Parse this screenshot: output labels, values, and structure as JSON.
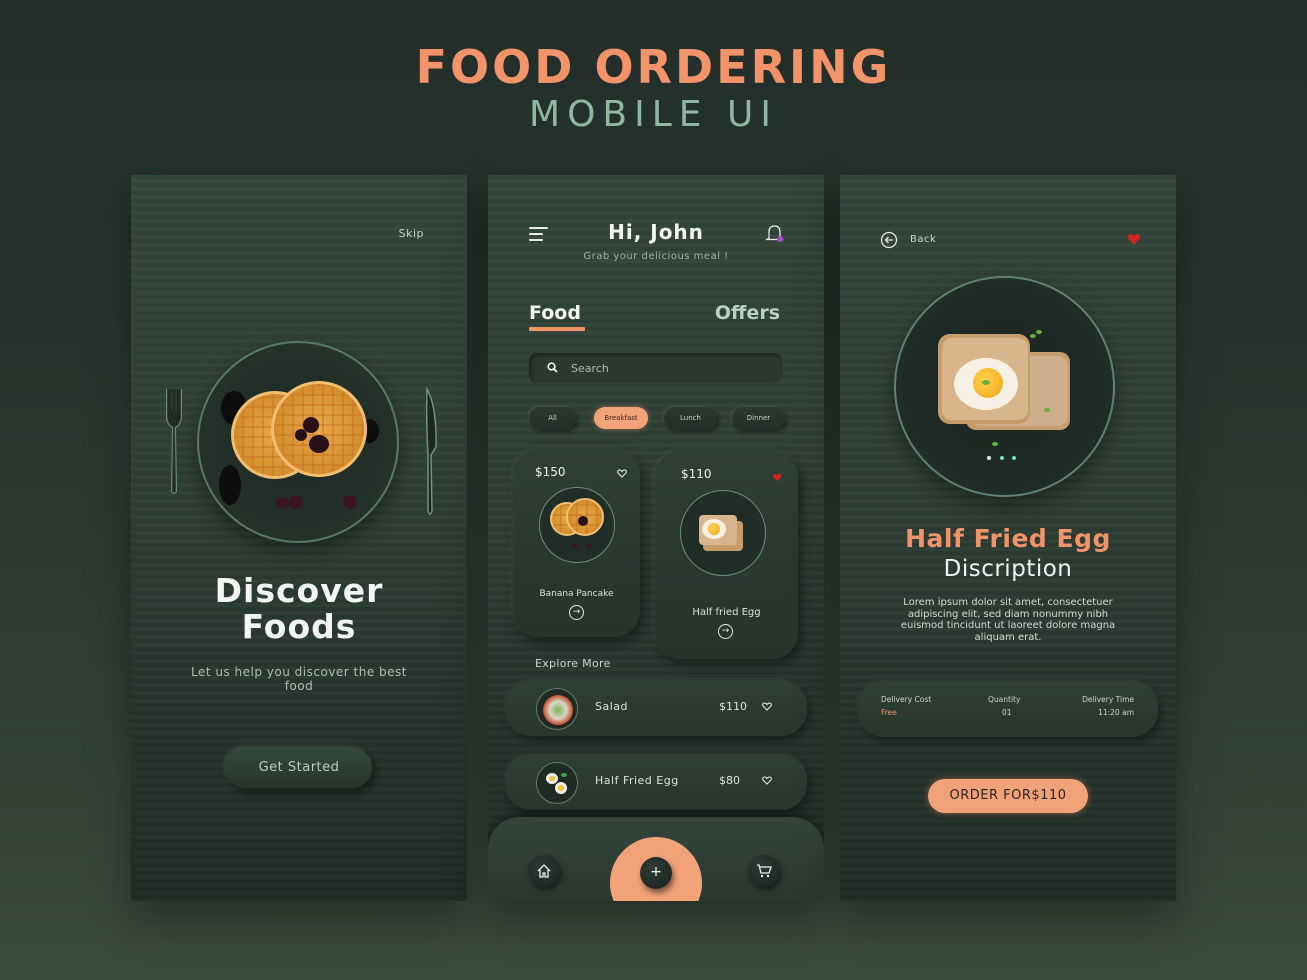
{
  "header": {
    "title": "FOOD ORDERING",
    "subtitle": "MOBILE UI"
  },
  "onboarding": {
    "skip_label": "Skip",
    "headline_line1": "Discover",
    "headline_line2": "Foods",
    "description": "Let us help you discover the best food",
    "cta_label": "Get Started"
  },
  "home": {
    "greeting": "Hi, John",
    "greeting_sub": "Grab your delicious meal !",
    "tabs": [
      {
        "label": "Food",
        "active": true
      },
      {
        "label": "Offers",
        "active": false
      }
    ],
    "search": {
      "placeholder": "Search",
      "value": ""
    },
    "categories": [
      {
        "label": "All",
        "active": false
      },
      {
        "label": "Breakfast",
        "active": true
      },
      {
        "label": "Lunch",
        "active": false
      },
      {
        "label": "Dinner",
        "active": false
      }
    ],
    "featured": [
      {
        "price": "$150",
        "name": "Banana Pancake",
        "favorite": false
      },
      {
        "price": "$110",
        "name": "Half fried Egg",
        "favorite": true
      }
    ],
    "explore_label": "Explore More",
    "explore_items": [
      {
        "name": "Salad",
        "price": "$110",
        "favorite": false
      },
      {
        "name": "Half Fried Egg",
        "price": "$80",
        "favorite": false
      }
    ],
    "nav": {
      "home_icon": "home-icon",
      "add_icon": "plus-icon",
      "add_symbol": "+",
      "cart_icon": "cart-icon"
    }
  },
  "detail": {
    "back_label": "Back",
    "favorite": true,
    "carousel": {
      "count": 3,
      "active_index": 0
    },
    "title": "Half Fried Egg",
    "subtitle": "Discription",
    "description": "Lorem ipsum dolor sit amet, consectetuer adipiscing elit, sed diam nonummy nibh euismod tincidunt ut laoreet dolore magna aliquam erat.",
    "info": [
      {
        "label": "Delivery Cost",
        "value": "Free"
      },
      {
        "label": "Quantity",
        "value": "01"
      },
      {
        "label": "Delivery Time",
        "value": "11:20 am"
      }
    ],
    "order_label": "ORDER FOR$110"
  },
  "colors": {
    "accent": "#f2936a",
    "accent_light": "#f2a278",
    "secondary_text": "#8fb7a2",
    "favorite_red": "#d8231e",
    "background_dark": "#232e2a",
    "panel": "#2f4036"
  }
}
